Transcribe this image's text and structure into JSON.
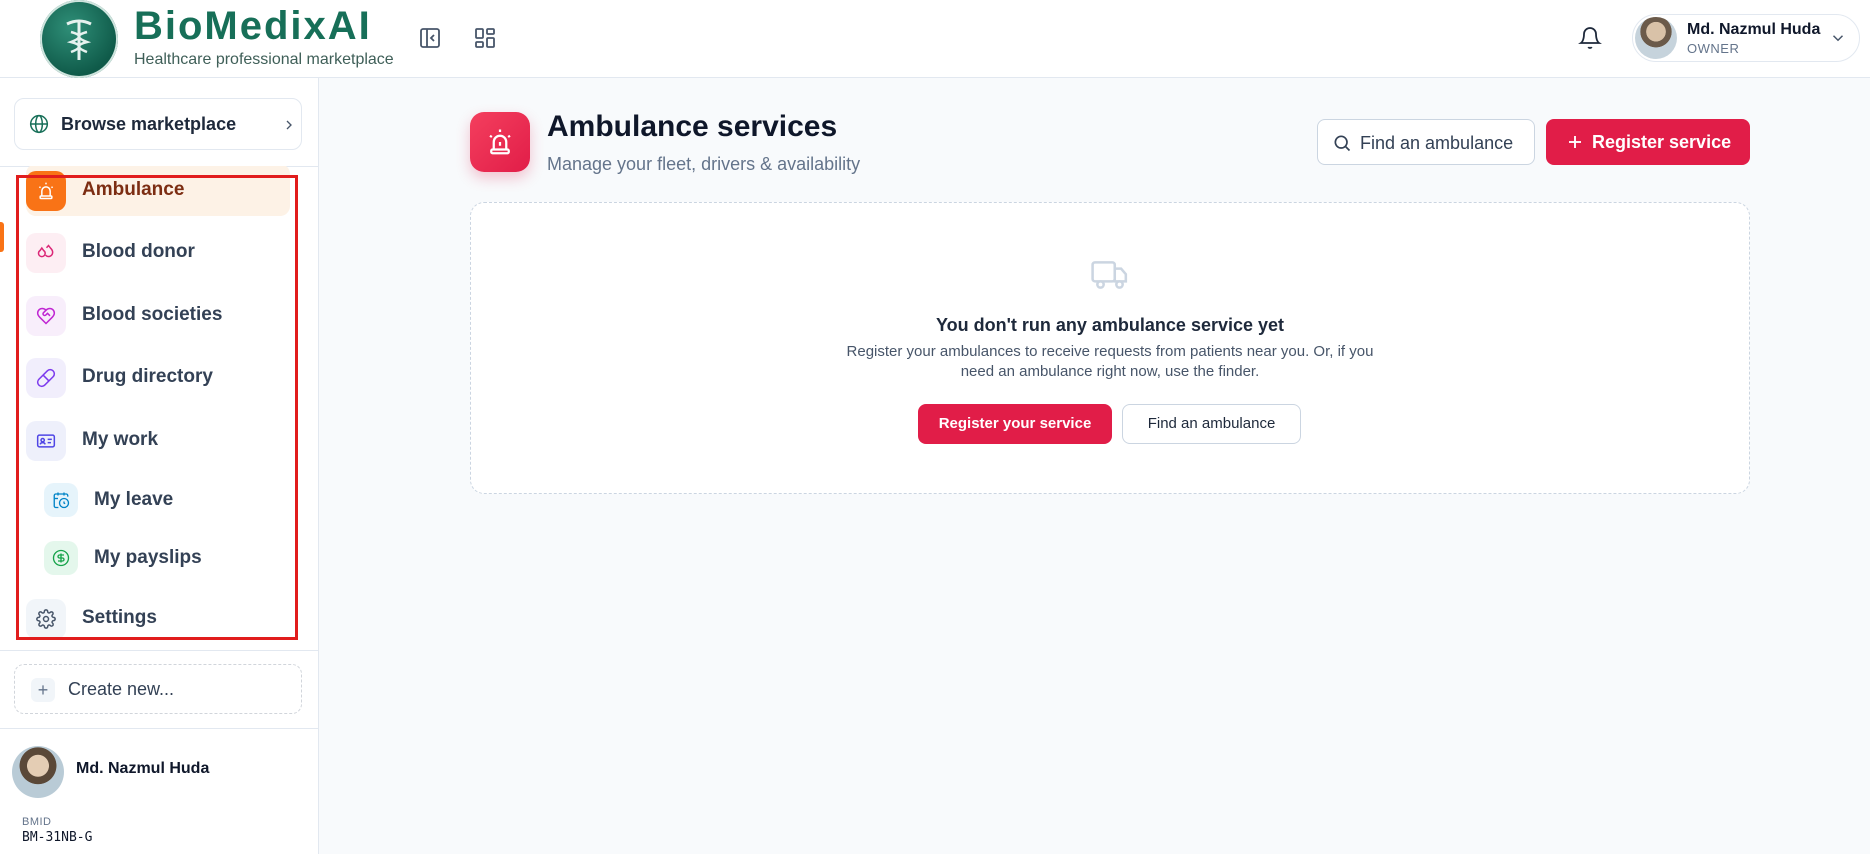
{
  "brand": {
    "title": "BioMedixAI",
    "subtitle": "Healthcare professional marketplace"
  },
  "user": {
    "name": "Md. Nazmul Huda",
    "role": "OWNER"
  },
  "sidebar": {
    "browse_label": "Browse marketplace",
    "items": [
      {
        "label": "Ambulance",
        "icon": "siren-icon",
        "active": true
      },
      {
        "label": "Blood donor",
        "icon": "droplets-icon"
      },
      {
        "label": "Blood societies",
        "icon": "heart-handshake-icon"
      },
      {
        "label": "Drug directory",
        "icon": "pill-icon"
      },
      {
        "label": "My work",
        "icon": "id-card-icon"
      },
      {
        "label": "My leave",
        "icon": "calendar-clock-icon"
      },
      {
        "label": "My payslips",
        "icon": "dollar-circle-icon"
      },
      {
        "label": "Settings",
        "icon": "gear-icon"
      }
    ],
    "create_label": "Create new...",
    "footer": {
      "name": "Md. Nazmul Huda",
      "bmid_label": "BMID",
      "bmid_value": "BM-31NB-G"
    }
  },
  "main": {
    "title": "Ambulance services",
    "subtitle": "Manage your fleet, drivers & availability",
    "find_label": "Find an ambulance",
    "register_label": "Register service",
    "empty": {
      "title": "You don't run any ambulance service yet",
      "description": "Register your ambulances to receive requests from patients near you. Or, if you need an ambulance right now, use the finder.",
      "primary_label": "Register your service",
      "secondary_label": "Find an ambulance"
    }
  },
  "colors": {
    "accent": "#e11d48",
    "brand": "#176f58",
    "active_bg": "#fdf2e6",
    "highlight": "#e11d1d"
  }
}
